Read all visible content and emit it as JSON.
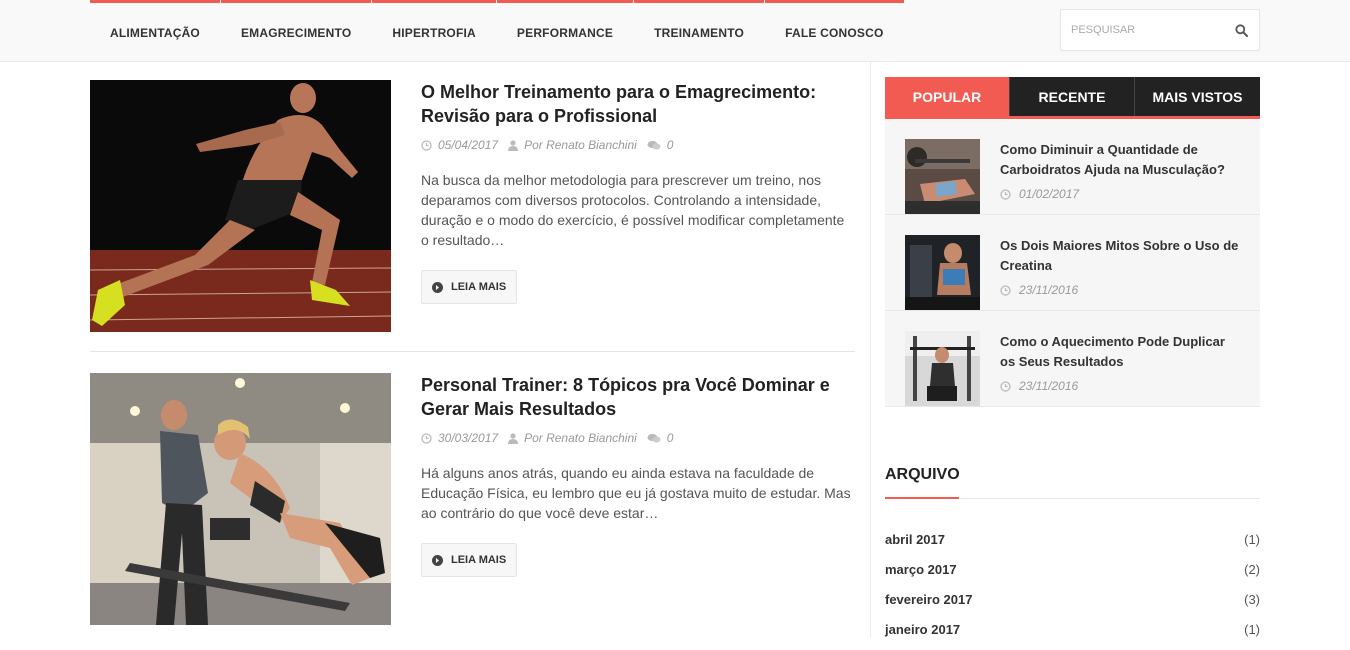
{
  "nav": {
    "items": [
      {
        "label": "ALIMENTAÇÃO"
      },
      {
        "label": "EMAGRECIMENTO"
      },
      {
        "label": "HIPERTROFIA"
      },
      {
        "label": "PERFORMANCE"
      },
      {
        "label": "TREINAMENTO"
      },
      {
        "label": "FALE CONOSCO"
      }
    ]
  },
  "search": {
    "placeholder": "PESQUISAR",
    "icon": "search-icon"
  },
  "posts": [
    {
      "title": "O Melhor Treinamento para o Emagrecimento: Revisão para o Profissional",
      "date": "05/04/2017",
      "author": "Por Renato Bianchini",
      "comments": "0",
      "excerpt": " Na busca da melhor metodologia para prescrever um treino, nos deparamos com diversos protocolos. Controlando a intensidade, duração e o modo do exercício, é possível modificar completamente o resultado…",
      "read_more": "LEIA MAIS"
    },
    {
      "title": "Personal Trainer: 8 Tópicos pra Você Dominar e Gerar Mais Resultados",
      "date": "30/03/2017",
      "author": "Por Renato Bianchini",
      "comments": "0",
      "excerpt": "Há alguns anos atrás, quando eu ainda estava na faculdade de Educação Física, eu lembro que eu já gostava muito de estudar. Mas ao contrário do que você deve estar…",
      "read_more": "LEIA MAIS"
    }
  ],
  "sidebar": {
    "tabs": [
      {
        "label": "POPULAR",
        "active": true
      },
      {
        "label": "RECENTE",
        "active": false
      },
      {
        "label": "MAIS VISTOS",
        "active": false
      }
    ],
    "items": [
      {
        "title": "Como Diminuir a Quantidade de Carboidratos Ajuda na Musculação?",
        "date": "01/02/2017"
      },
      {
        "title": "Os Dois Maiores Mitos Sobre o Uso de Creatina",
        "date": "23/11/2016"
      },
      {
        "title": "Como o Aquecimento Pode Duplicar os Seus Resultados",
        "date": "23/11/2016"
      }
    ],
    "archive": {
      "title": "ARQUIVO",
      "items": [
        {
          "name": "abril 2017",
          "count": "(1)"
        },
        {
          "name": "março 2017",
          "count": "(2)"
        },
        {
          "name": "fevereiro 2017",
          "count": "(3)"
        },
        {
          "name": "janeiro 2017",
          "count": "(1)"
        }
      ]
    }
  },
  "colors": {
    "accent": "#f25b52",
    "dark_tab": "#222222",
    "sidebar_bg": "#f6f6f6"
  }
}
